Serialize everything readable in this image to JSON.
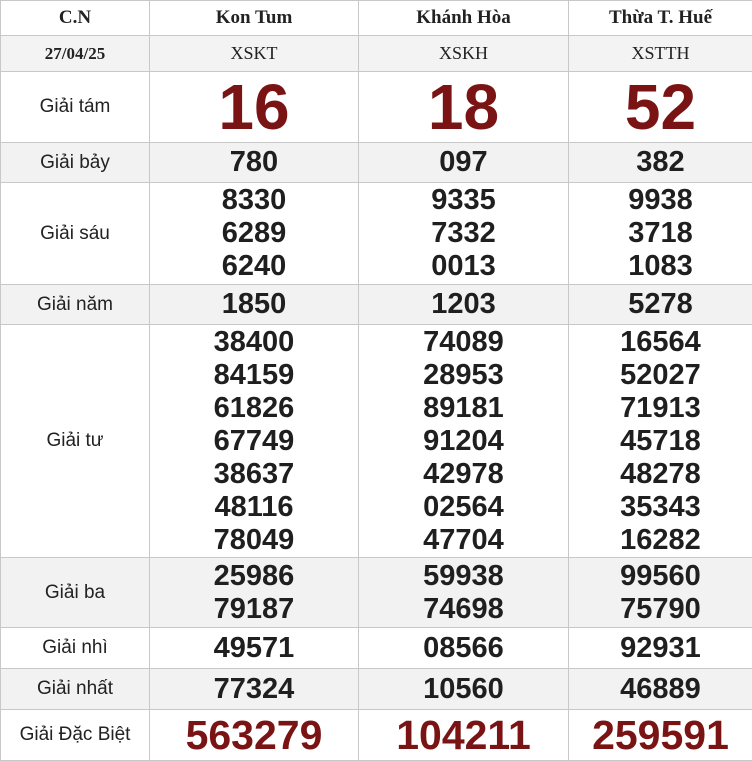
{
  "header": {
    "day": "C.N",
    "provinces": [
      "Kon Tum",
      "Khánh Hòa",
      "Thừa T. Huế"
    ]
  },
  "subheader": {
    "date": "27/04/25",
    "codes": [
      "XSKT",
      "XSKH",
      "XSTTH"
    ]
  },
  "labels": {
    "g8": "Giải tám",
    "g7": "Giải bảy",
    "g6": "Giải sáu",
    "g5": "Giải năm",
    "g4": "Giải tư",
    "g3": "Giải ba",
    "g2": "Giải nhì",
    "g1": "Giải nhất",
    "db": "Giải Đặc Biệt"
  },
  "results": [
    {
      "g8": "16",
      "g7": "780",
      "g6": [
        "8330",
        "6289",
        "6240"
      ],
      "g5": "1850",
      "g4": [
        "38400",
        "84159",
        "61826",
        "67749",
        "38637",
        "48116",
        "78049"
      ],
      "g3": [
        "25986",
        "79187"
      ],
      "g2": "49571",
      "g1": "77324",
      "db": "563279"
    },
    {
      "g8": "18",
      "g7": "097",
      "g6": [
        "9335",
        "7332",
        "0013"
      ],
      "g5": "1203",
      "g4": [
        "74089",
        "28953",
        "89181",
        "91204",
        "42978",
        "02564",
        "47704"
      ],
      "g3": [
        "59938",
        "74698"
      ],
      "g2": "08566",
      "g1": "10560",
      "db": "104211"
    },
    {
      "g8": "52",
      "g7": "382",
      "g6": [
        "9938",
        "3718",
        "1083"
      ],
      "g5": "5278",
      "g4": [
        "16564",
        "52027",
        "71913",
        "45718",
        "48278",
        "35343",
        "16282"
      ],
      "g3": [
        "99560",
        "75790"
      ],
      "g2": "92931",
      "g1": "46889",
      "db": "259591"
    }
  ],
  "colors": {
    "header_text": "#1c3fa0",
    "special_number": "#7a1414",
    "row_shade": "#f2f2f2",
    "border": "#c8c8c8"
  }
}
